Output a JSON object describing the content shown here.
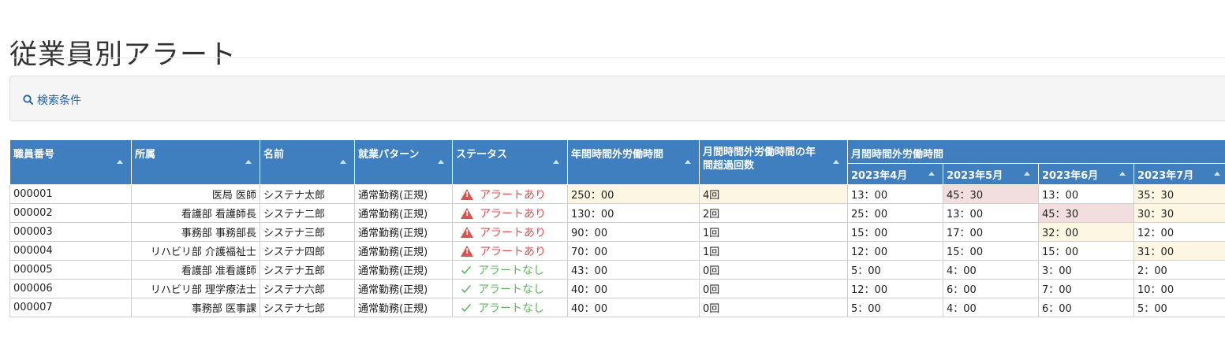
{
  "page": {
    "title": "従業員別アラート"
  },
  "search": {
    "toggle_label": "検索条件"
  },
  "table": {
    "headers": {
      "staff_no": "職員番号",
      "dept": "所属",
      "name": "名前",
      "pattern": "就業パターン",
      "status": "ステータス",
      "annual_ot": "年間時間外労働時間",
      "monthly_exceed": "月間時間外労働時間の年間超過回数",
      "monthly_group": "月間時間外労働時間",
      "months": [
        "2023年4月",
        "2023年5月",
        "2023年6月",
        "2023年7月"
      ]
    },
    "rows": [
      {
        "staff_no": "000001",
        "dept": "医局 医師",
        "name": "システナ太郎",
        "pattern": "通常勤務(正規)",
        "status": "アラートあり",
        "alert": true,
        "annual_ot": "250：00",
        "exceed": "4回",
        "months": [
          "13：00",
          "45：30",
          "13：00",
          "35：30"
        ],
        "month_level": [
          "",
          "danger",
          "",
          "warn"
        ],
        "annual_level": "warn",
        "exceed_level": "warn"
      },
      {
        "staff_no": "000002",
        "dept": "看護部 看護師長",
        "name": "システナ二郎",
        "pattern": "通常勤務(正規)",
        "status": "アラートあり",
        "alert": true,
        "annual_ot": "130：00",
        "exceed": "2回",
        "months": [
          "25：00",
          "13：00",
          "45：30",
          "30：30"
        ],
        "month_level": [
          "",
          "",
          "danger",
          "warn"
        ],
        "annual_level": "",
        "exceed_level": ""
      },
      {
        "staff_no": "000003",
        "dept": "事務部 事務部長",
        "name": "システナ三郎",
        "pattern": "通常勤務(正規)",
        "status": "アラートあり",
        "alert": true,
        "annual_ot": "90：00",
        "exceed": "1回",
        "months": [
          "15：00",
          "17：00",
          "32：00",
          "12：00"
        ],
        "month_level": [
          "",
          "",
          "warn",
          ""
        ],
        "annual_level": "",
        "exceed_level": ""
      },
      {
        "staff_no": "000004",
        "dept": "リハビリ部 介護福祉士",
        "name": "システナ四郎",
        "pattern": "通常勤務(正規)",
        "status": "アラートあり",
        "alert": true,
        "annual_ot": "70：00",
        "exceed": "1回",
        "months": [
          "12：00",
          "15：00",
          "15：00",
          "31：00"
        ],
        "month_level": [
          "",
          "",
          "",
          "warn"
        ],
        "annual_level": "",
        "exceed_level": ""
      },
      {
        "staff_no": "000005",
        "dept": "看護部 准看護師",
        "name": "システナ五郎",
        "pattern": "通常勤務(正規)",
        "status": "アラートなし",
        "alert": false,
        "annual_ot": "43：00",
        "exceed": "0回",
        "months": [
          "5：00",
          "4：00",
          "3：00",
          "2：00"
        ],
        "month_level": [
          "",
          "",
          "",
          ""
        ],
        "annual_level": "",
        "exceed_level": ""
      },
      {
        "staff_no": "000006",
        "dept": "リハビリ部 理学療法士",
        "name": "システナ六郎",
        "pattern": "通常勤務(正規)",
        "status": "アラートなし",
        "alert": false,
        "annual_ot": "40：00",
        "exceed": "0回",
        "months": [
          "12：00",
          "6：00",
          "7：00",
          "10：00"
        ],
        "month_level": [
          "",
          "",
          "",
          ""
        ],
        "annual_level": "",
        "exceed_level": ""
      },
      {
        "staff_no": "000007",
        "dept": "事務部 医事課",
        "name": "システナ七郎",
        "pattern": "通常勤務(正規)",
        "status": "アラートなし",
        "alert": false,
        "annual_ot": "40：00",
        "exceed": "0回",
        "months": [
          "5：00",
          "4：00",
          "6：00",
          "5：00"
        ],
        "month_level": [
          "",
          "",
          "",
          ""
        ],
        "annual_level": "",
        "exceed_level": ""
      }
    ]
  },
  "colors": {
    "header_bg": "#3f7fc0",
    "alert": "#d9534f",
    "ok": "#5cb85c",
    "warn_bg": "#fcf6e3",
    "danger_bg": "#f2dede",
    "link": "#1f5fa8"
  }
}
